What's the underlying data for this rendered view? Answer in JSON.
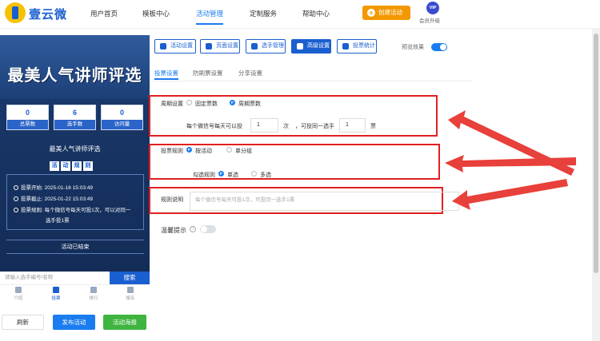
{
  "brand": {
    "name": "壹云微",
    "mark": "1"
  },
  "nav": {
    "items": [
      "用户首页",
      "模板中心",
      "活动管理",
      "定制服务",
      "帮助中心"
    ],
    "active_index": 2,
    "create_label": "创建活动",
    "vip_badge": "VIP",
    "vip_label": "会员升级"
  },
  "preview": {
    "banner_title": "最美人气讲师评选",
    "stats": [
      {
        "value": "0",
        "label": "总票数"
      },
      {
        "value": "6",
        "label": "选手数"
      },
      {
        "value": "0",
        "label": "访问量"
      }
    ],
    "activity_name": "最美人气讲师评选",
    "rules_title": [
      "活",
      "动",
      "规",
      "则"
    ],
    "rules": [
      "投票开始:  2025-01-16 15:03:49",
      "投票截止:  2025-01-22 15:03:49",
      "投票规则:  每个微信号每天可投1次，可以对同一",
      "选手投1票"
    ],
    "ended_label": "活动已结束",
    "search_placeholder": "请输入选手编号/名称",
    "search_button": "搜索",
    "tabs": [
      "介绍",
      "投票",
      "排行",
      "报名"
    ],
    "active_tab": 1
  },
  "footer_buttons": {
    "refresh": "刷新",
    "publish": "发布活动",
    "poster": "活动海报"
  },
  "tools": [
    "活动设置",
    "页面设置",
    "选手管理",
    "高级设置",
    "投票统计"
  ],
  "active_tool": 3,
  "preview_effect": {
    "label": "预览效果",
    "on": true
  },
  "subtabs": [
    "投票设置",
    "防刷票设置",
    "分享设置"
  ],
  "active_subtab": 0,
  "cycle": {
    "label": "周期设置",
    "options": [
      "固定票数",
      "周期票数"
    ],
    "selected": 1,
    "text1": "每个微信号每天可以投",
    "value1": "1",
    "unit1": "次",
    "text2": "，可投同一选手",
    "value2": "1",
    "unit2": "票"
  },
  "vote_rule": {
    "label": "投票规则",
    "options": [
      "按活动",
      "单分组"
    ],
    "selected": 0,
    "check_label": "勾选规则",
    "check_options": [
      "单选",
      "多选"
    ],
    "check_selected": 0
  },
  "rule_desc": {
    "label": "规则说明",
    "placeholder": "每个微信号每天可投1次，可投同一选手1票"
  },
  "reminder": {
    "label": "温馨提示",
    "help": "?",
    "on": false
  },
  "colors": {
    "accent": "#1a7cf0",
    "highlight": "#e02020",
    "orange": "#f39800",
    "green": "#3fb43f"
  }
}
